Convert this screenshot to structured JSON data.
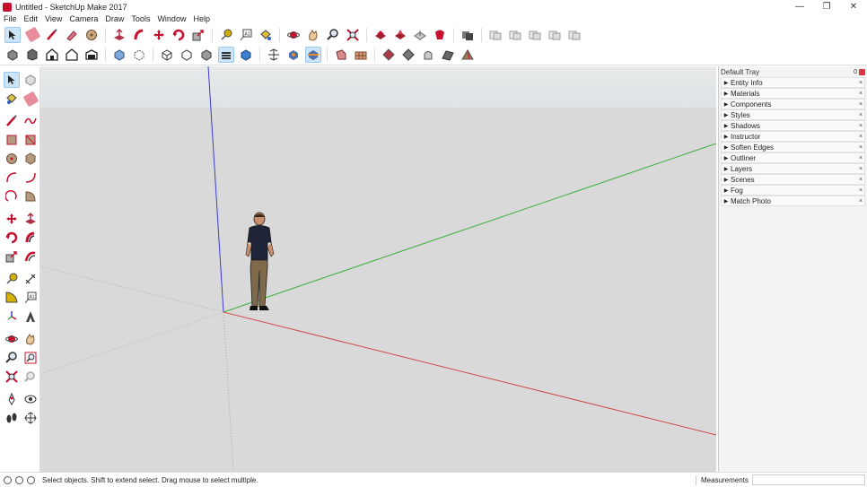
{
  "window": {
    "title": "Untitled - SketchUp Make 2017",
    "minimize": "—",
    "maximize": "❐",
    "close": "✕"
  },
  "menu": [
    "File",
    "Edit",
    "View",
    "Camera",
    "Draw",
    "Tools",
    "Window",
    "Help"
  ],
  "tray": {
    "title": "Default Tray",
    "pin": "0",
    "panels": [
      "Entity Info",
      "Materials",
      "Components",
      "Styles",
      "Shadows",
      "Instructor",
      "Soften Edges",
      "Outliner",
      "Layers",
      "Scenes",
      "Fog",
      "Match Photo"
    ]
  },
  "status": {
    "hint": "Select objects. Shift to extend select. Drag mouse to select multiple.",
    "measurements_label": "Measurements",
    "measurements_value": ""
  },
  "colors": {
    "red_axis": "#d14b4b",
    "green_axis": "#3fae3f",
    "blue_axis": "#3b3bd1",
    "ground": "#d9d9d9",
    "sky": "#e5e7e8",
    "accent": "#c8102e"
  },
  "icons": {
    "toolbar_row1": [
      "select-icon",
      "eraser-icon",
      "pencil-icon",
      "rectangle-icon",
      "circle-icon",
      "push-pull-icon",
      "follow-me-icon",
      "move-icon",
      "rotate-icon",
      "scale-icon",
      "tape-measure-icon",
      "text-icon",
      "paint-bucket-icon",
      "orbit-icon",
      "pan-icon",
      "zoom-icon",
      "zoom-extents-icon",
      "warehouse-icon",
      "share-model-icon",
      "upload-icon",
      "extension-warehouse-icon",
      "layout-icon",
      "component-1-icon",
      "component-2-icon",
      "component-3-icon",
      "component-4-icon",
      "component-5-icon"
    ],
    "toolbar_row2": [
      "iso-view-icon",
      "top-view-icon",
      "front-view-icon",
      "right-view-icon",
      "back-view-icon",
      "left-view-icon",
      "xray-icon",
      "back-edges-icon",
      "wireframe-icon",
      "hidden-line-icon",
      "shaded-icon",
      "shaded-textures-icon",
      "monochrome-icon",
      "section-plane-icon",
      "display-section-icon",
      "display-cuts-icon",
      "solid-union-icon",
      "solid-subtract-icon",
      "outer-shell-icon",
      "intersect-icon",
      "trim-icon",
      "split-icon",
      "sandbox-icon"
    ]
  }
}
